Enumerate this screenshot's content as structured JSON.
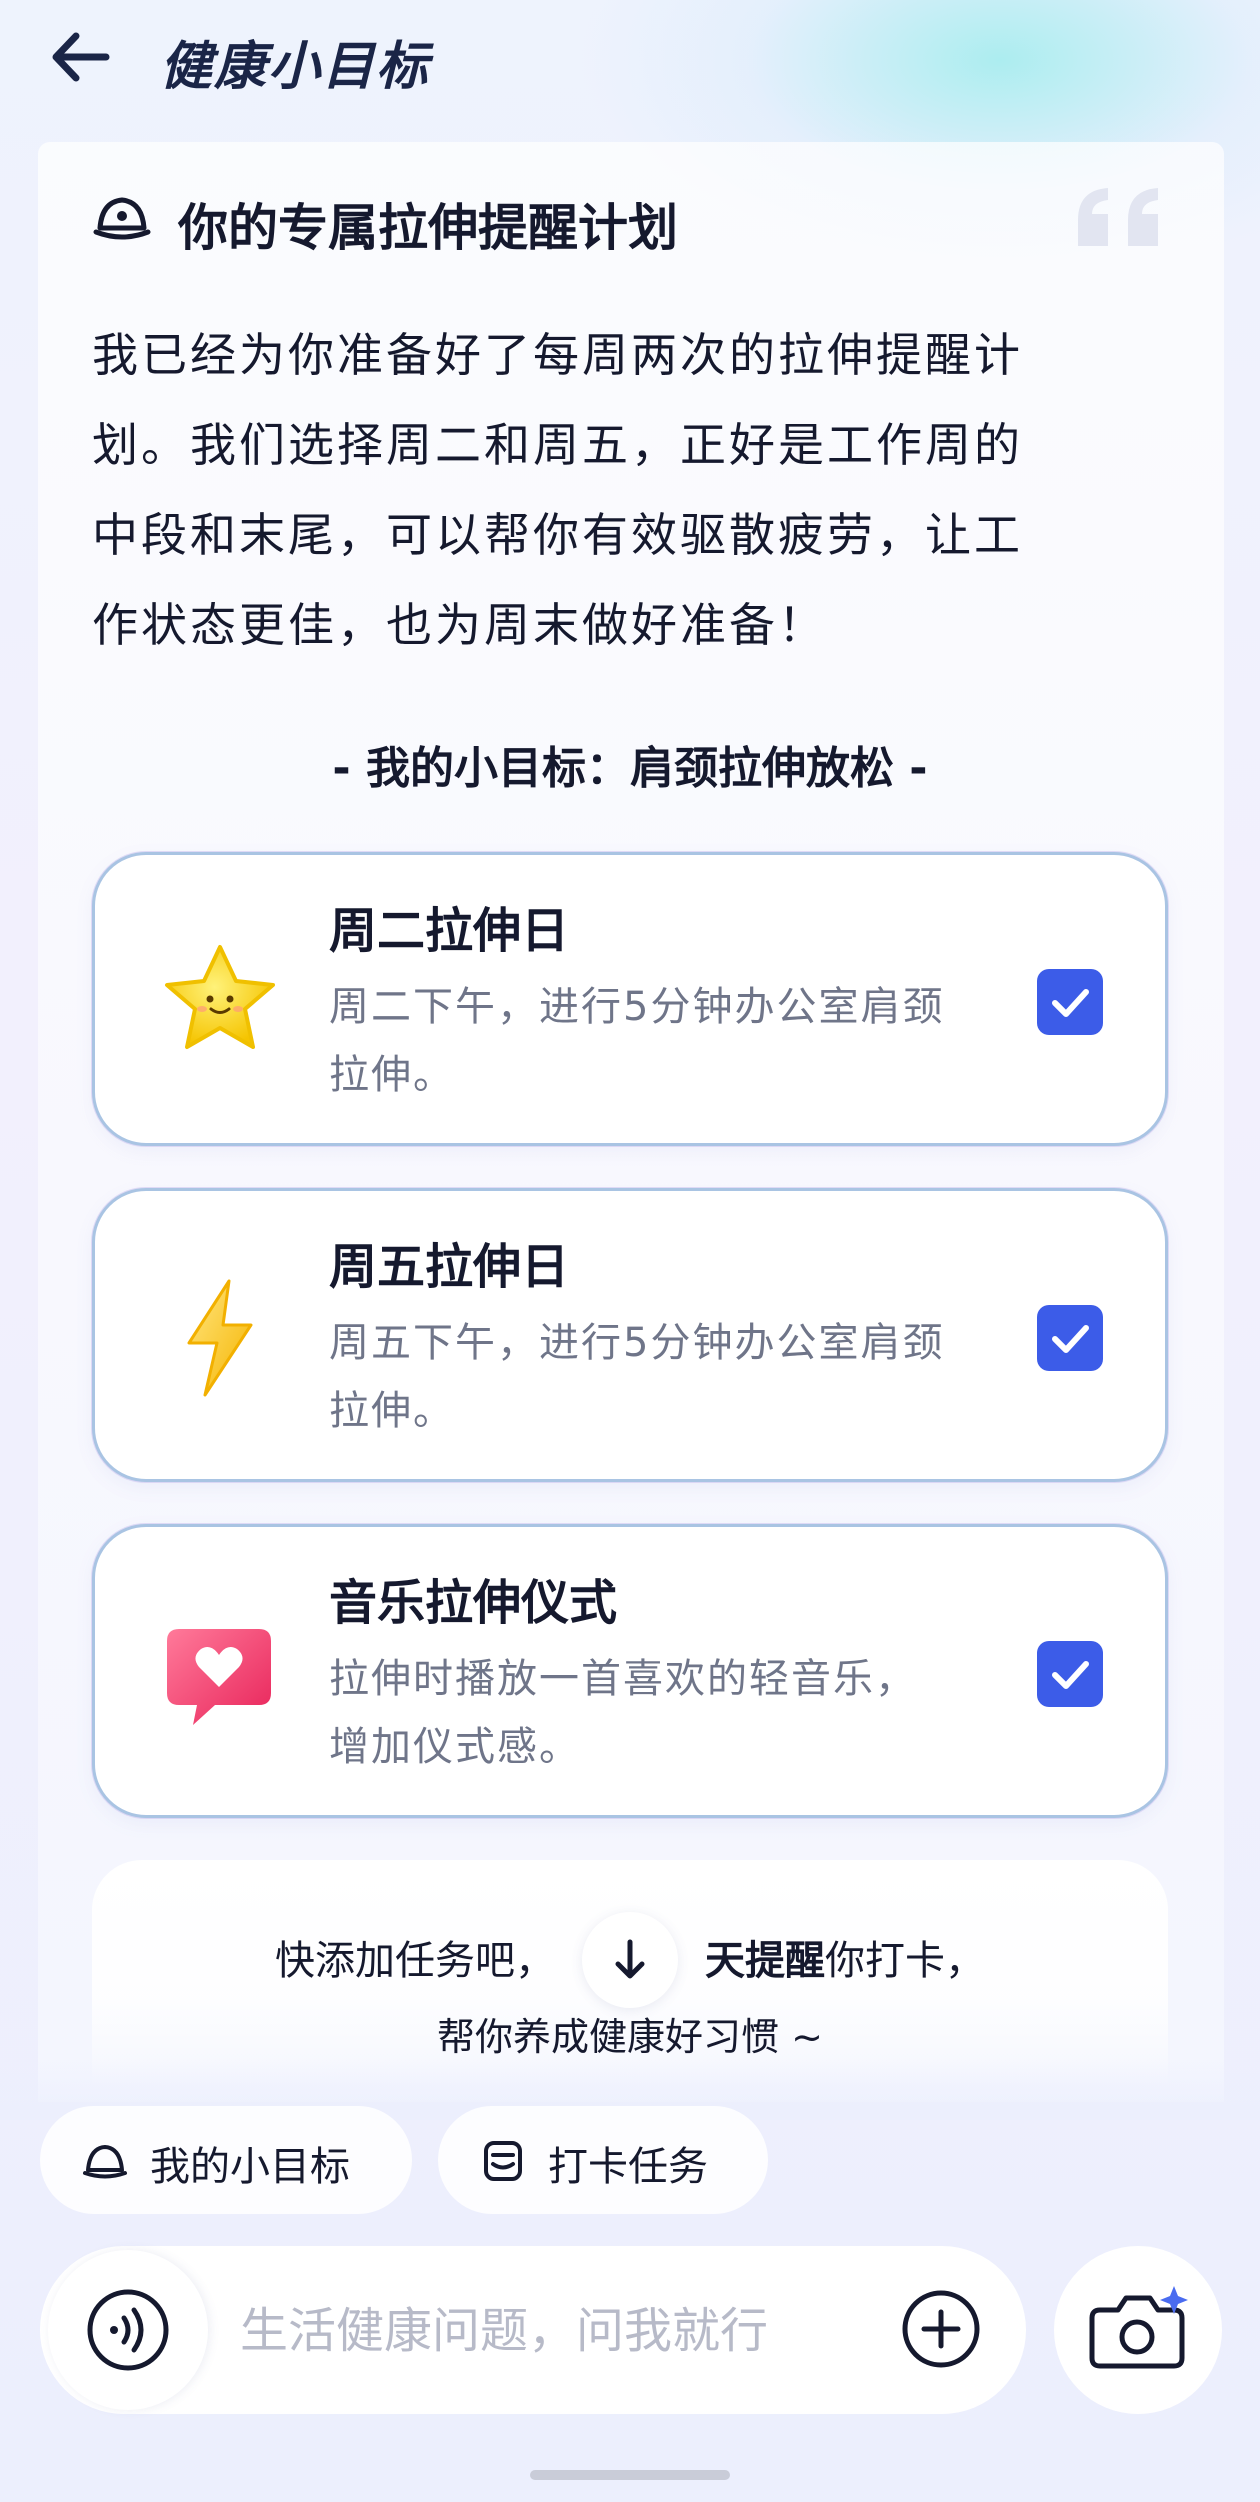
{
  "header": {
    "title": "健康小目标",
    "back_icon": "arrow-left-icon"
  },
  "plan": {
    "title": "你的专属拉伸提醒计划",
    "icon": "hat-icon",
    "quote_icon": "quote-icon",
    "intro_lines": [
      "我已经为你准备好了每周两次的拉伸提醒计",
      "划。我们选择周二和周五，正好是工作周的",
      "中段和末尾，可以帮你有效驱散疲劳，让工",
      "作状态更佳，也为周末做好准备！"
    ],
    "goal_heading": "- 我的小目标：肩颈拉伸放松 -"
  },
  "tasks": [
    {
      "title": "周二拉伸日",
      "desc_lines": [
        "周二下午，进行5分钟办公室肩颈",
        "拉伸。"
      ],
      "icon": "star-icon",
      "checked": true
    },
    {
      "title": "周五拉伸日",
      "desc_lines": [
        "周五下午，进行5分钟办公室肩颈",
        "拉伸。"
      ],
      "icon": "lightning-icon",
      "checked": true
    },
    {
      "title": "音乐拉伸仪式",
      "desc_lines": [
        "拉伸时播放一首喜欢的轻音乐，",
        "增加仪式感。"
      ],
      "icon": "heart-message-icon",
      "checked": true
    }
  ],
  "hint": {
    "line1_pre": "快添加任务吧，",
    "line1_bold": "天提醒",
    "line1_post": "你打卡，",
    "line2": "帮你养成健康好习惯 ~"
  },
  "chips": [
    {
      "label": "我的小目标",
      "icon": "hat-icon"
    },
    {
      "label": "打卡任务",
      "icon": "checkin-icon"
    }
  ],
  "input": {
    "placeholder": "生活健康问题，问我就行",
    "voice_icon": "voice-icon",
    "plus_icon": "plus-icon",
    "camera_icon": "camera-icon"
  },
  "colors": {
    "accent": "#3c5ce8",
    "text": "#15192e",
    "muted": "#6f7589"
  }
}
